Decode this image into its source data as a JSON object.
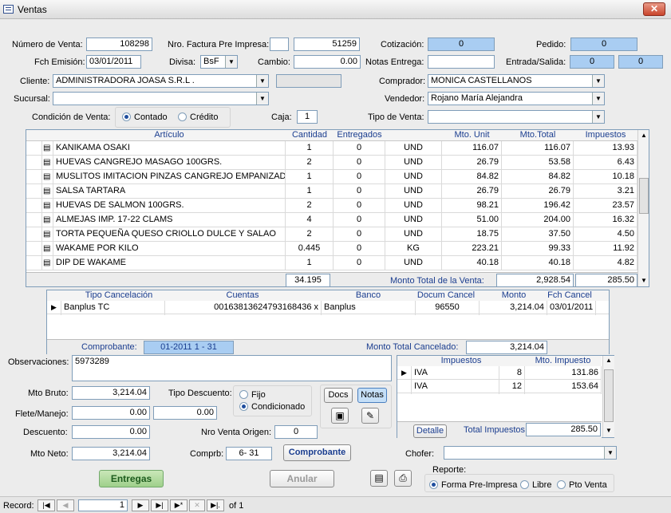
{
  "window": {
    "title": "Ventas",
    "close": "✕"
  },
  "header": {
    "numero_venta_label": "Número de Venta:",
    "numero_venta": "108298",
    "factura_label": "Nro. Factura Pre Impresa:",
    "factura_pre": "",
    "factura_num": "51259",
    "cotizacion_label": "Cotización:",
    "cotizacion": "0",
    "pedido_label": "Pedido:",
    "pedido": "0",
    "fch_emision_label": "Fch Emisión:",
    "fch_emision": "03/01/2011",
    "divisa_label": "Divisa:",
    "divisa": "BsF",
    "cambio_label": "Cambio:",
    "cambio": "0.00",
    "notas_entrega_label": "Notas Entrega:",
    "notas_entrega": "",
    "entrada_salida_label": "Entrada/Salida:",
    "entrada": "0",
    "salida": "0",
    "cliente_label": "Cliente:",
    "cliente": "ADMINISTRADORA JOASA S.R.L .",
    "comprador_label": "Comprador:",
    "comprador": "MONICA CASTELLANOS",
    "sucursal_label": "Sucursal:",
    "sucursal": "",
    "vendedor_label": "Vendedor:",
    "vendedor": "Rojano María Alejandra",
    "condicion_label": "Condición de Venta:",
    "contado": "Contado",
    "credito": "Crédito",
    "caja_label": "Caja:",
    "caja": "1",
    "tipo_venta_label": "Tipo de Venta:",
    "tipo_venta": ""
  },
  "articles": {
    "columns": [
      "Artículo",
      "Cantidad",
      "Entregados",
      "",
      "Mto. Unit",
      "Mto.Total",
      "Impuestos"
    ],
    "rows": [
      [
        "KANIKAMA OSAKI",
        "1",
        "0",
        "UND",
        "116.07",
        "116.07",
        "13.93"
      ],
      [
        "HUEVAS CANGREJO MASAGO 100GRS.",
        "2",
        "0",
        "UND",
        "26.79",
        "53.58",
        "6.43"
      ],
      [
        "MUSLITOS IMITACION PINZAS CANGREJO EMPANIZADA",
        "1",
        "0",
        "UND",
        "84.82",
        "84.82",
        "10.18"
      ],
      [
        "SALSA TARTARA",
        "1",
        "0",
        "UND",
        "26.79",
        "26.79",
        "3.21"
      ],
      [
        "HUEVAS DE SALMON 100GRS.",
        "2",
        "0",
        "UND",
        "98.21",
        "196.42",
        "23.57"
      ],
      [
        "ALMEJAS IMP. 17-22 CLAMS",
        "4",
        "0",
        "UND",
        "51.00",
        "204.00",
        "16.32"
      ],
      [
        "TORTA PEQUEÑA  QUESO CRIOLLO DULCE Y SALAO",
        "2",
        "0",
        "UND",
        "18.75",
        "37.50",
        "4.50"
      ],
      [
        "WAKAME POR KILO",
        "0.445",
        "0",
        "KG",
        "223.21",
        "99.33",
        "11.92"
      ],
      [
        "DIP DE WAKAME",
        "1",
        "0",
        "UND",
        "40.18",
        "40.18",
        "4.82"
      ]
    ],
    "total_cantidad": "34.195",
    "monto_total_label": "Monto Total de la Venta:",
    "monto_total": "2,928.54",
    "total_impuestos": "285.50"
  },
  "payments": {
    "columns": [
      "Tipo Cancelación",
      "Cuentas",
      "Banco",
      "Docum Cancel",
      "Monto",
      "Fch Cancel"
    ],
    "rows": [
      [
        "Banplus TC",
        "00163813624793168436 x",
        "Banplus",
        "96550",
        "3,214.04",
        "03/01/2011"
      ]
    ],
    "comprobante_label": "Comprobante:",
    "comprobante": "01-2011  1 - 31",
    "monto_cancelado_label": "Monto Total Cancelado:",
    "monto_cancelado": "3,214.04"
  },
  "bottom": {
    "observaciones_label": "Observaciones:",
    "observaciones": "5973289",
    "mto_bruto_label": "Mto Bruto:",
    "mto_bruto": "3,214.04",
    "tipo_descuento_label": "Tipo Descuento:",
    "fijo": "Fijo",
    "condicionado": "Condicionado",
    "flete_label": "Flete/Manejo:",
    "flete1": "0.00",
    "flete2": "0.00",
    "descuento_label": "Descuento:",
    "descuento": "0.00",
    "nro_venta_origen_label": "Nro Venta Origen:",
    "nro_venta_origen": "0",
    "mto_neto_label": "Mto Neto:",
    "mto_neto": "3,214.04",
    "comprb_label": "Comprb:",
    "comprb": "6- 31",
    "comprobante_btn": "Comprobante",
    "docs_btn": "Docs",
    "notas_btn": "Notas",
    "entregas_btn": "Entregas",
    "anular_btn": "Anular",
    "chofer_label": "Chofer:",
    "chofer": "",
    "reporte_label": "Reporte:",
    "forma_pre": "Forma Pre-Impresa",
    "libre": "Libre",
    "pto_venta": "Pto Venta"
  },
  "taxes": {
    "columns": [
      "Impuestos",
      "",
      "Mto. Impuesto"
    ],
    "rows": [
      [
        "IVA",
        "8",
        "131.86"
      ],
      [
        "IVA",
        "12",
        "153.64"
      ]
    ],
    "detalle_btn": "Detalle",
    "total_label": "Total Impuestos:",
    "total": "285.50"
  },
  "record": {
    "label": "Record:",
    "current": "1",
    "of": "of  1"
  }
}
